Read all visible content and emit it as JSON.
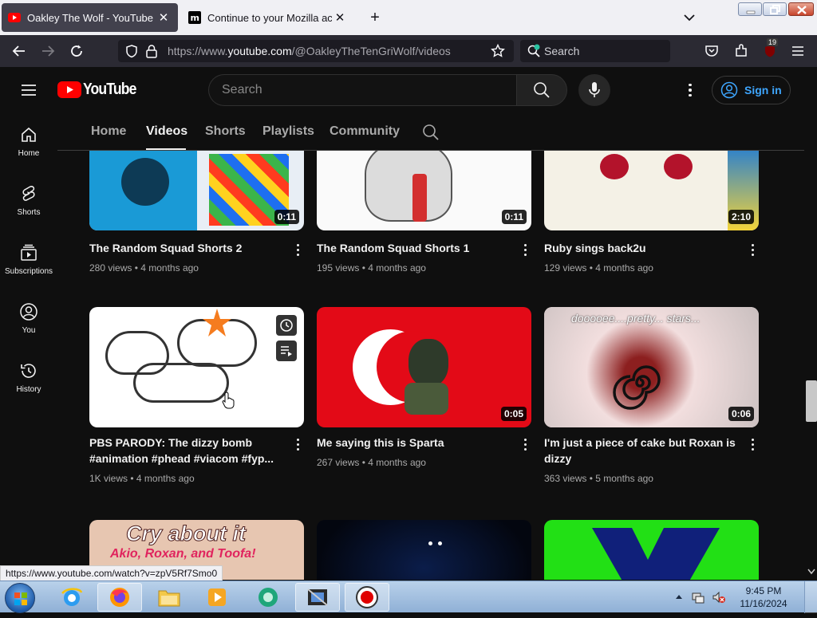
{
  "browser": {
    "tabs": [
      {
        "title": "Oakley The Wolf - YouTube",
        "active": true
      },
      {
        "title": "Continue to your Mozilla accou",
        "active": false
      }
    ],
    "url_prefix": "https://www.",
    "url_domain": "youtube.com",
    "url_path": "/@OakleyTheTenGriWolf/videos",
    "search_placeholder": "Search",
    "extension_badge": "19"
  },
  "youtube": {
    "logo_text": "YouTube",
    "search_placeholder": "Search",
    "signin_label": "Sign in",
    "rail": [
      {
        "label": "Home",
        "icon": "home-icon"
      },
      {
        "label": "Shorts",
        "icon": "shorts-icon"
      },
      {
        "label": "Subscriptions",
        "icon": "subscriptions-icon"
      },
      {
        "label": "You",
        "icon": "you-icon"
      },
      {
        "label": "History",
        "icon": "history-icon"
      }
    ],
    "channel_tabs": [
      "Home",
      "Videos",
      "Shorts",
      "Playlists",
      "Community"
    ],
    "active_tab": "Videos",
    "videos": [
      {
        "title": "The Random Squad Shorts 2",
        "views": "280 views",
        "age": "4 months ago",
        "duration": "0:11"
      },
      {
        "title": "The Random Squad Shorts 1",
        "views": "195 views",
        "age": "4 months ago",
        "duration": "0:11"
      },
      {
        "title": "Ruby sings back2u",
        "views": "129 views",
        "age": "4 months ago",
        "duration": "2:10"
      },
      {
        "title": "PBS PARODY: The dizzy bomb",
        "title2": "#animation #phead #viacom #fyp...",
        "views": "1K views",
        "age": "4 months ago",
        "duration": ""
      },
      {
        "title": "Me saying this is Sparta",
        "views": "267 views",
        "age": "4 months ago",
        "duration": "0:05"
      },
      {
        "title": "I'm just a piece of cake but Roxan is",
        "title2": "dizzy",
        "views": "363 views",
        "age": "5 months ago",
        "duration": "0:06"
      }
    ],
    "thumb_texts": {
      "cake_caption": "dooooee....pretty... stars...",
      "cry_line1": "Cry about it",
      "cry_line2": "Akio, Roxan, and Toofa!"
    }
  },
  "status_url": "https://www.youtube.com/watch?v=zpV5Rf7Smo0",
  "taskbar": {
    "time": "9:45 PM",
    "date": "11/16/2024"
  },
  "colors": {
    "yt_red": "#ff0000",
    "yt_bg": "#0f0f0f",
    "link_blue": "#3ea6ff"
  }
}
